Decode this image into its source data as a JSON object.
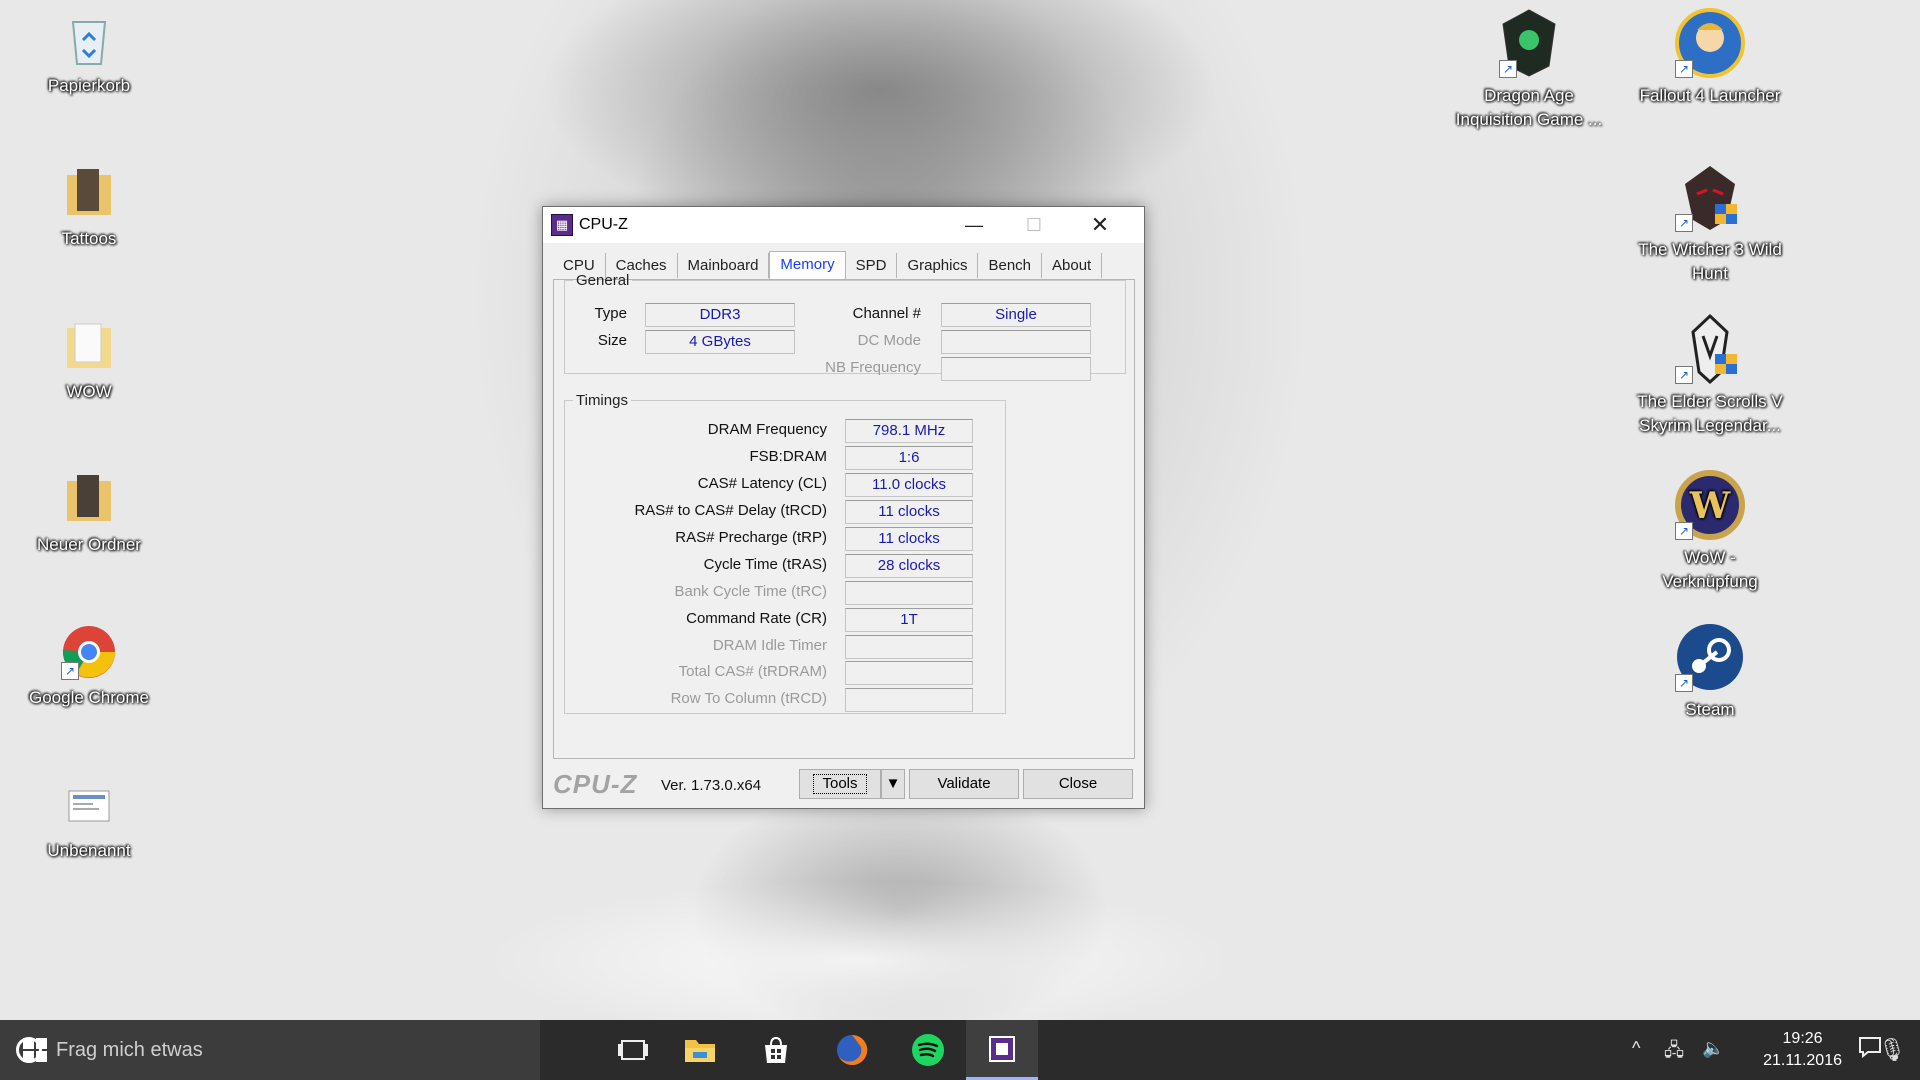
{
  "desktop": {
    "left_icons": [
      {
        "label": "Papierkorb",
        "icon": "recycle-bin-icon"
      },
      {
        "label": "Tattoos",
        "icon": "folder-icon"
      },
      {
        "label": "WOW",
        "icon": "folder-icon"
      },
      {
        "label": "Neuer Ordner",
        "icon": "folder-icon"
      },
      {
        "label": "Google Chrome",
        "icon": "chrome-icon"
      },
      {
        "label": "Unbenannt",
        "icon": "document-icon"
      }
    ],
    "right_icons": [
      {
        "label": "Dragon Age Inquisition Game ...",
        "icon": "dragon-age-icon"
      },
      {
        "label": "Fallout 4 Launcher",
        "icon": "fallout-icon"
      },
      {
        "label": "The Witcher 3 Wild Hunt",
        "icon": "witcher-icon"
      },
      {
        "label": "The Elder Scrolls V Skyrim Legendar...",
        "icon": "skyrim-icon"
      },
      {
        "label": "WoW - Verknüpfung",
        "icon": "wow-icon"
      },
      {
        "label": "Steam",
        "icon": "steam-icon"
      }
    ]
  },
  "window": {
    "title": "CPU-Z",
    "tabs": [
      "CPU",
      "Caches",
      "Mainboard",
      "Memory",
      "SPD",
      "Graphics",
      "Bench",
      "About"
    ],
    "active_tab": "Memory",
    "general": {
      "legend": "General",
      "type_label": "Type",
      "type_value": "DDR3",
      "size_label": "Size",
      "size_value": "4 GBytes",
      "channel_label": "Channel #",
      "channel_value": "Single",
      "dcmode_label": "DC Mode",
      "dcmode_value": "",
      "nbfreq_label": "NB Frequency",
      "nbfreq_value": ""
    },
    "timings": {
      "legend": "Timings",
      "rows": [
        {
          "label": "DRAM Frequency",
          "value": "798.1 MHz",
          "enabled": true
        },
        {
          "label": "FSB:DRAM",
          "value": "1:6",
          "enabled": true
        },
        {
          "label": "CAS# Latency (CL)",
          "value": "11.0 clocks",
          "enabled": true
        },
        {
          "label": "RAS# to CAS# Delay (tRCD)",
          "value": "11 clocks",
          "enabled": true
        },
        {
          "label": "RAS# Precharge (tRP)",
          "value": "11 clocks",
          "enabled": true
        },
        {
          "label": "Cycle Time (tRAS)",
          "value": "28 clocks",
          "enabled": true
        },
        {
          "label": "Bank Cycle Time (tRC)",
          "value": "",
          "enabled": false
        },
        {
          "label": "Command Rate (CR)",
          "value": "1T",
          "enabled": true
        },
        {
          "label": "DRAM Idle Timer",
          "value": "",
          "enabled": false
        },
        {
          "label": "Total CAS# (tRDRAM)",
          "value": "",
          "enabled": false
        },
        {
          "label": "Row To Column (tRCD)",
          "value": "",
          "enabled": false
        }
      ]
    },
    "footer": {
      "brand": "CPU-Z",
      "version": "Ver. 1.73.0.x64",
      "tools_label": "Tools",
      "validate_label": "Validate",
      "close_label": "Close"
    }
  },
  "taskbar": {
    "search_placeholder": "Frag mich etwas",
    "time": "19:26",
    "date": "21.11.2016"
  },
  "colors": {
    "active_tab": "#1a3cff",
    "value_text": "#1a1ab0",
    "taskbar": "#2b2b2b"
  }
}
